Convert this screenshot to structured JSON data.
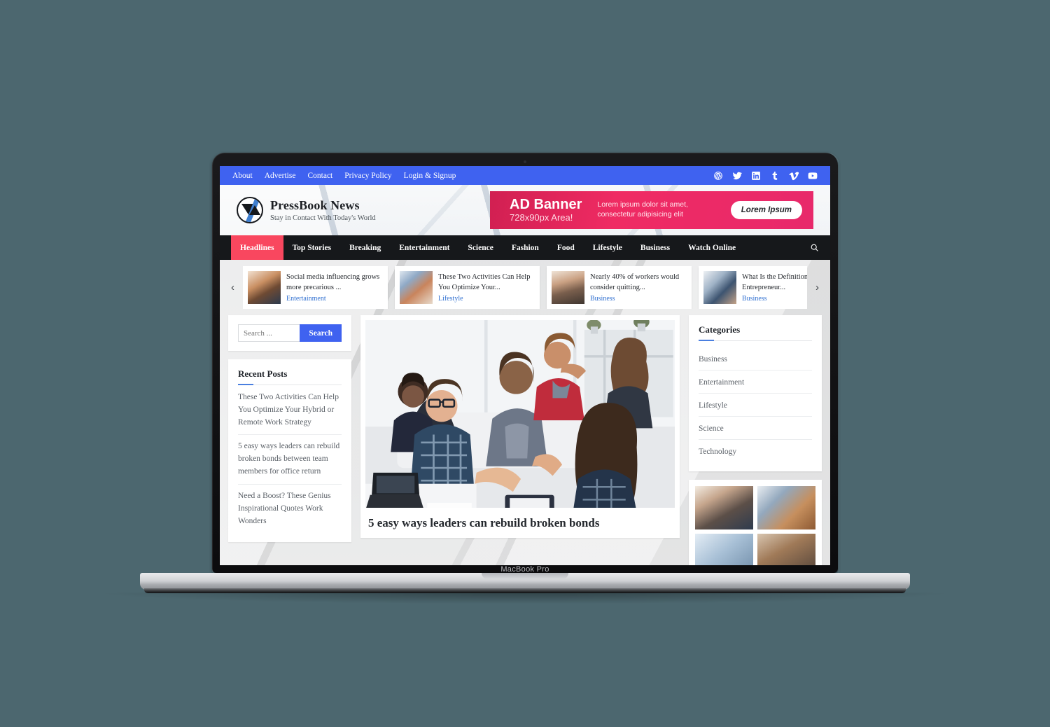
{
  "device": {
    "label": "MacBook Pro"
  },
  "topbar": {
    "links": [
      {
        "label": "About"
      },
      {
        "label": "Advertise"
      },
      {
        "label": "Contact"
      },
      {
        "label": "Privacy Policy"
      },
      {
        "label": "Login & Signup"
      }
    ],
    "social": [
      {
        "name": "wordpress-icon"
      },
      {
        "name": "twitter-icon"
      },
      {
        "name": "linkedin-icon"
      },
      {
        "name": "tumblr-icon"
      },
      {
        "name": "vimeo-icon"
      },
      {
        "name": "youtube-icon"
      }
    ],
    "background_color": "#3f62f0"
  },
  "header": {
    "brand_title": "PressBook News",
    "brand_tagline": "Stay in Contact With Today's World",
    "ad": {
      "title": "AD Banner",
      "subtitle": "728x90px Area!",
      "copy": "Lorem ipsum dolor sit amet, consectetur adipisicing elit",
      "cta": "Lorem Ipsum",
      "color": "#ef2b63"
    }
  },
  "mainnav": {
    "items": [
      {
        "label": "Headlines",
        "active": true
      },
      {
        "label": "Top Stories",
        "active": false
      },
      {
        "label": "Breaking",
        "active": false
      },
      {
        "label": "Entertainment",
        "active": false
      },
      {
        "label": "Science",
        "active": false
      },
      {
        "label": "Fashion",
        "active": false
      },
      {
        "label": "Food",
        "active": false
      },
      {
        "label": "Lifestyle",
        "active": false
      },
      {
        "label": "Business",
        "active": false
      },
      {
        "label": "Watch Online",
        "active": false
      }
    ],
    "active_color": "#f9475f",
    "background_color": "#16181b",
    "search_icon": "search-icon"
  },
  "carousel": {
    "prev_label": "‹",
    "next_label": "›",
    "cards": [
      {
        "title": "Social media influencing grows more precarious ...",
        "category": "Entertainment"
      },
      {
        "title": "These Two Activities Can Help You Optimize Your...",
        "category": "Lifestyle"
      },
      {
        "title": "Nearly 40% of workers would consider quitting...",
        "category": "Business"
      },
      {
        "title": "What Is the Definition of an Entrepreneur...",
        "category": "Business"
      }
    ]
  },
  "sidebar_left": {
    "search": {
      "placeholder": "Search ...",
      "value": "",
      "button_label": "Search"
    },
    "recent_posts": {
      "title": "Recent Posts",
      "items": [
        {
          "label": "These Two Activities Can Help You Optimize Your Hybrid or Remote Work Strategy"
        },
        {
          "label": "5 easy ways leaders can rebuild broken bonds between team members for office return"
        },
        {
          "label": "Need a Boost? These Genius Inspirational Quotes Work Wonders"
        }
      ]
    }
  },
  "main": {
    "article": {
      "title": "5 easy ways leaders can rebuild broken bonds",
      "image_alt": "office-meeting-photo"
    }
  },
  "sidebar_right": {
    "categories": {
      "title": "Categories",
      "items": [
        {
          "label": "Business"
        },
        {
          "label": "Entertainment"
        },
        {
          "label": "Lifestyle"
        },
        {
          "label": "Science"
        },
        {
          "label": "Technology"
        }
      ]
    },
    "gallery": {
      "cells": [
        {
          "alt": "woman-at-desk-photo"
        },
        {
          "alt": "hands-on-keyboard-photo"
        },
        {
          "alt": "gallery-photo-3"
        },
        {
          "alt": "gallery-photo-4"
        }
      ]
    }
  }
}
